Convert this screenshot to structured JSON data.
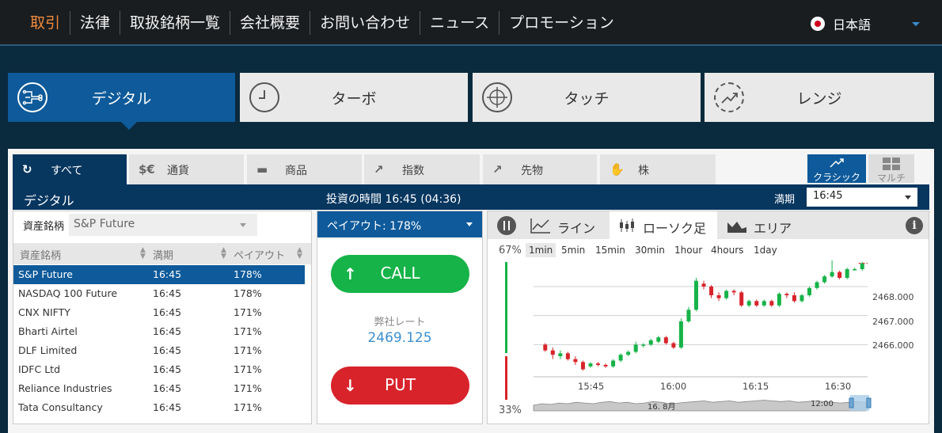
{
  "nav": {
    "items": [
      "取引",
      "法律",
      "取扱銘柄一覧",
      "会社概要",
      "お問い合わせ",
      "ニュース",
      "プロモーション"
    ],
    "active_index": 0,
    "language": "日本語"
  },
  "product_tabs": [
    {
      "label": "デジタル",
      "icon": "circuit-icon",
      "active": true
    },
    {
      "label": "ターボ",
      "icon": "clock-icon",
      "active": false
    },
    {
      "label": "タッチ",
      "icon": "target-icon",
      "active": false
    },
    {
      "label": "レンジ",
      "icon": "trend-icon",
      "active": false
    }
  ],
  "categories": [
    {
      "label": "すべて",
      "icon": "refresh-icon",
      "glyph": "↻",
      "active": true
    },
    {
      "label": "通貨",
      "icon": "currency-icon",
      "glyph": "$€",
      "active": false
    },
    {
      "label": "商品",
      "icon": "gold-bars-icon",
      "glyph": "▬",
      "active": false
    },
    {
      "label": "指数",
      "icon": "index-chart-icon",
      "glyph": "↗",
      "active": false
    },
    {
      "label": "先物",
      "icon": "futures-chart-icon",
      "glyph": "↗",
      "active": false
    },
    {
      "label": "株",
      "icon": "handshake-icon",
      "glyph": "✋",
      "active": false
    }
  ],
  "view_modes": {
    "classic": "クラシック",
    "multi": "マルチ"
  },
  "bar": {
    "title": "デジタル",
    "investment_time": "投資の時間 16:45 (04:36)",
    "expiry_label": "満期",
    "expiry_value": "16:45"
  },
  "asset_selector": {
    "label": "資産銘柄",
    "value": "S&P Future"
  },
  "asset_table": {
    "headers": [
      "資産銘柄",
      "満期",
      "ペイアウト"
    ],
    "rows": [
      [
        "S&P Future",
        "16:45",
        "178%"
      ],
      [
        "NASDAQ 100 Future",
        "16:45",
        "178%"
      ],
      [
        "CNX NIFTY",
        "16:45",
        "171%"
      ],
      [
        "Bharti Airtel",
        "16:45",
        "171%"
      ],
      [
        "DLF Limited",
        "16:45",
        "171%"
      ],
      [
        "IDFC Ltd",
        "16:45",
        "171%"
      ],
      [
        "Reliance Industries",
        "16:45",
        "171%"
      ],
      [
        "Tata Consultancy",
        "16:45",
        "171%"
      ]
    ],
    "selected_index": 0
  },
  "trade": {
    "payout": "ペイアウト:  178%",
    "call": "CALL",
    "put": "PUT",
    "rate_label": "弊社レート",
    "rate_value": "2469.125"
  },
  "chart_tabs": [
    {
      "label": "ライン",
      "icon": "line-chart-icon",
      "active": false
    },
    {
      "label": "ローソク足",
      "icon": "candlestick-icon",
      "active": true
    },
    {
      "label": "エリア",
      "icon": "area-chart-icon",
      "active": false
    }
  ],
  "sentiment": {
    "up": "67%",
    "down": "33%",
    "up_fraction": 0.67
  },
  "timeframes": [
    "1min",
    "5min",
    "15min",
    "30min",
    "1hour",
    "4hours",
    "1day"
  ],
  "active_timeframe": 0,
  "navigator_labels": [
    "16. 8月",
    "12:00"
  ],
  "colors": {
    "up": "#16b348",
    "down": "#d8232a",
    "brand": "#0e5a9a",
    "accent": "#f08a3c"
  },
  "chart_data": {
    "type": "candlestick",
    "x_ticks": [
      "15:45",
      "16:00",
      "16:15",
      "16:30"
    ],
    "y_ticks": [
      "2466.000",
      "2467.000",
      "2468.000"
    ],
    "ylim": [
      2465.0,
      2468.9
    ],
    "candles": [
      {
        "t": "15:38",
        "o": 2466.0,
        "h": 2466.05,
        "l": 2465.75,
        "c": 2465.8
      },
      {
        "t": "15:39",
        "o": 2465.8,
        "h": 2465.9,
        "l": 2465.5,
        "c": 2465.65
      },
      {
        "t": "15:40",
        "o": 2465.6,
        "h": 2465.8,
        "l": 2465.5,
        "c": 2465.7
      },
      {
        "t": "15:41",
        "o": 2465.7,
        "h": 2465.75,
        "l": 2465.45,
        "c": 2465.5
      },
      {
        "t": "15:42",
        "o": 2465.5,
        "h": 2465.6,
        "l": 2465.3,
        "c": 2465.4
      },
      {
        "t": "15:43",
        "o": 2465.4,
        "h": 2465.45,
        "l": 2465.1,
        "c": 2465.15
      },
      {
        "t": "15:44",
        "o": 2465.25,
        "h": 2465.4,
        "l": 2465.2,
        "c": 2465.35
      },
      {
        "t": "15:45",
        "o": 2465.35,
        "h": 2465.4,
        "l": 2465.25,
        "c": 2465.3
      },
      {
        "t": "15:46",
        "o": 2465.3,
        "h": 2465.35,
        "l": 2465.2,
        "c": 2465.25
      },
      {
        "t": "15:47",
        "o": 2465.25,
        "h": 2465.5,
        "l": 2465.2,
        "c": 2465.45
      },
      {
        "t": "15:48",
        "o": 2465.45,
        "h": 2465.7,
        "l": 2465.4,
        "c": 2465.65
      },
      {
        "t": "15:49",
        "o": 2465.65,
        "h": 2465.8,
        "l": 2465.6,
        "c": 2465.75
      },
      {
        "t": "15:50",
        "o": 2465.75,
        "h": 2466.1,
        "l": 2465.7,
        "c": 2466.0
      },
      {
        "t": "15:51",
        "o": 2466.0,
        "h": 2466.05,
        "l": 2465.9,
        "c": 2466.0
      },
      {
        "t": "15:52",
        "o": 2466.0,
        "h": 2466.2,
        "l": 2465.95,
        "c": 2466.15
      },
      {
        "t": "15:53",
        "o": 2466.1,
        "h": 2466.3,
        "l": 2466.05,
        "c": 2466.25
      },
      {
        "t": "15:54",
        "o": 2466.25,
        "h": 2466.3,
        "l": 2466.0,
        "c": 2466.05
      },
      {
        "t": "15:55",
        "o": 2466.05,
        "h": 2466.1,
        "l": 2465.85,
        "c": 2465.9
      },
      {
        "t": "15:56",
        "o": 2465.9,
        "h": 2466.9,
        "l": 2465.85,
        "c": 2466.8
      },
      {
        "t": "15:57",
        "o": 2466.8,
        "h": 2467.3,
        "l": 2466.75,
        "c": 2467.2
      },
      {
        "t": "15:58",
        "o": 2467.2,
        "h": 2468.3,
        "l": 2467.15,
        "c": 2468.2
      },
      {
        "t": "15:59",
        "o": 2468.1,
        "h": 2468.2,
        "l": 2467.9,
        "c": 2468.0
      },
      {
        "t": "16:00",
        "o": 2468.0,
        "h": 2468.05,
        "l": 2467.6,
        "c": 2467.7
      },
      {
        "t": "16:01",
        "o": 2467.7,
        "h": 2467.8,
        "l": 2467.5,
        "c": 2467.6
      },
      {
        "t": "16:02",
        "o": 2467.6,
        "h": 2467.9,
        "l": 2467.55,
        "c": 2467.85
      },
      {
        "t": "16:03",
        "o": 2467.85,
        "h": 2467.9,
        "l": 2467.7,
        "c": 2467.8
      },
      {
        "t": "16:04",
        "o": 2467.8,
        "h": 2467.85,
        "l": 2467.3,
        "c": 2467.35
      },
      {
        "t": "16:05",
        "o": 2467.35,
        "h": 2467.55,
        "l": 2467.3,
        "c": 2467.5
      },
      {
        "t": "16:06",
        "o": 2467.5,
        "h": 2467.55,
        "l": 2467.3,
        "c": 2467.35
      },
      {
        "t": "16:07",
        "o": 2467.35,
        "h": 2467.55,
        "l": 2467.3,
        "c": 2467.5
      },
      {
        "t": "16:08",
        "o": 2467.5,
        "h": 2467.55,
        "l": 2467.3,
        "c": 2467.35
      },
      {
        "t": "16:09",
        "o": 2467.35,
        "h": 2467.8,
        "l": 2467.3,
        "c": 2467.75
      },
      {
        "t": "16:10",
        "o": 2467.75,
        "h": 2467.8,
        "l": 2467.6,
        "c": 2467.7
      },
      {
        "t": "16:11",
        "o": 2467.7,
        "h": 2467.8,
        "l": 2467.45,
        "c": 2467.5
      },
      {
        "t": "16:12",
        "o": 2467.5,
        "h": 2467.75,
        "l": 2467.45,
        "c": 2467.7
      },
      {
        "t": "16:13",
        "o": 2467.7,
        "h": 2468.0,
        "l": 2467.65,
        "c": 2467.95
      },
      {
        "t": "16:14",
        "o": 2467.95,
        "h": 2468.2,
        "l": 2467.9,
        "c": 2468.15
      },
      {
        "t": "16:15",
        "o": 2468.15,
        "h": 2468.4,
        "l": 2468.1,
        "c": 2468.35
      },
      {
        "t": "16:16",
        "o": 2468.35,
        "h": 2468.9,
        "l": 2468.3,
        "c": 2468.5
      },
      {
        "t": "16:17",
        "o": 2468.5,
        "h": 2468.55,
        "l": 2468.25,
        "c": 2468.3
      },
      {
        "t": "16:18",
        "o": 2468.3,
        "h": 2468.65,
        "l": 2468.25,
        "c": 2468.6
      },
      {
        "t": "16:19",
        "o": 2468.6,
        "h": 2468.65,
        "l": 2468.55,
        "c": 2468.6
      },
      {
        "t": "16:20",
        "o": 2468.6,
        "h": 2468.85,
        "l": 2468.55,
        "c": 2468.8
      }
    ],
    "grid": true
  }
}
